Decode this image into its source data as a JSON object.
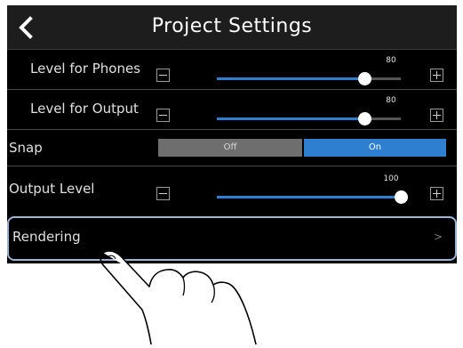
{
  "caption_text": "",
  "header": {
    "title": "Project Settings",
    "back_icon": "chevron-left-icon"
  },
  "rows": {
    "level_phones": {
      "label": "Level for Phones",
      "value": "80",
      "level_fraction": 0.8
    },
    "level_output": {
      "label": "Level for Output",
      "value": "80",
      "level_fraction": 0.8
    },
    "snap": {
      "label": "Snap",
      "off_label": "Off",
      "on_label": "On",
      "selected": "On"
    },
    "output_level": {
      "label": "Output Level",
      "value": "100",
      "level_fraction": 1.0
    },
    "rendering": {
      "label": "Rendering",
      "chevron": ">"
    }
  },
  "colors": {
    "accent": "#2f7fd0",
    "highlight_border": "#9db3d4",
    "background": "#000000"
  },
  "icons": [
    "chevron-left-icon",
    "minus-icon",
    "plus-icon",
    "chevron-right-icon",
    "pointing-hand-icon"
  ]
}
